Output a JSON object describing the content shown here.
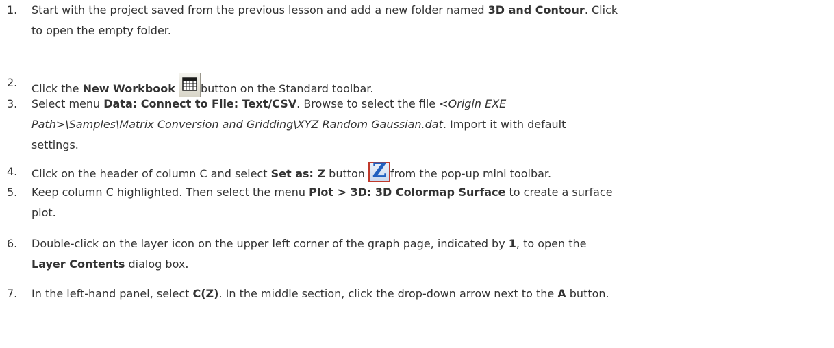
{
  "steps": [
    {
      "number": "1.",
      "t1": "Start with the project saved from the previous lesson and add a new folder named ",
      "b1": "3D and Contour",
      "t2": ". Click",
      "t3": "to open the empty folder."
    },
    {
      "number": "2.",
      "t1": "Click the ",
      "b1": "New Workbook",
      "icon": "new-workbook-icon",
      "t2": "button on the Standard toolbar."
    },
    {
      "number": "3.",
      "t1": "Select menu ",
      "b1": "Data: Connect to File: Text/CSV",
      "t2": ". Browse to select the file ",
      "i1": "<Origin EXE",
      "i2": "Path>\\Samples\\Matrix Conversion and Gridding\\XYZ Random Gaussian.dat",
      "t3": ". Import it with default",
      "t4": "settings."
    },
    {
      "number": "4.",
      "t1": "Click on the header of column C and select ",
      "b1": "Set as: Z",
      "t2": " button ",
      "icon": "set-as-z-icon",
      "icon_glyph": "Z",
      "t3": "from the pop-up mini toolbar."
    },
    {
      "number": "5.",
      "t1": "Keep column C highlighted. Then select the menu ",
      "b1": "Plot > 3D: 3D Colormap Surface",
      "t2": " to create a surface",
      "t3": "plot."
    },
    {
      "number": "6.",
      "t1": "Double-click on the layer icon on the upper left corner of the graph page, indicated by ",
      "b1": "1",
      "t2": ", to open the",
      "b2": "Layer Contents",
      "t3": " dialog box."
    },
    {
      "number": "7.",
      "t1": "In the left-hand panel, select ",
      "b1": "C(Z)",
      "t2": ". In the middle section, click the drop-down arrow next to the ",
      "b2": "A",
      "t3": " button."
    }
  ]
}
